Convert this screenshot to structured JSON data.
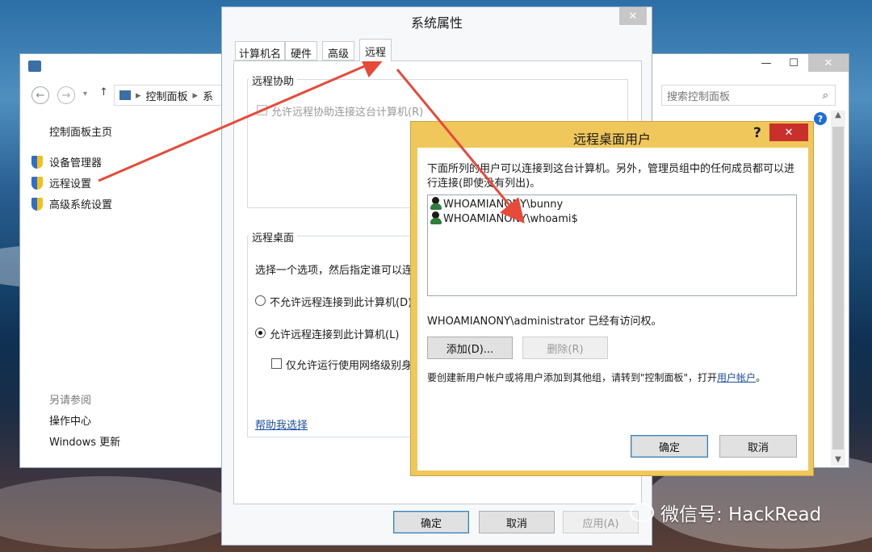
{
  "control_panel": {
    "breadcrumb_root": "控制面板",
    "breadcrumb_next": "系",
    "search_placeholder": "搜索控制面板",
    "home_link": "控制面板主页",
    "nav": [
      "设备管理器",
      "远程设置",
      "高级系统设置"
    ],
    "see_also_title": "另请参阅",
    "see_also": [
      "操作中心",
      "Windows 更新"
    ],
    "icons": [
      "back-icon",
      "forward-icon",
      "up-arrow-icon",
      "search-icon",
      "help-icon",
      "shield-icon"
    ]
  },
  "system_properties": {
    "title": "系统属性",
    "tabs": [
      "计算机名",
      "硬件",
      "高级",
      "远程"
    ],
    "active_tab": "远程",
    "remote_assistance": {
      "group_title": "远程协助",
      "checkbox_label": "允许远程协助连接这台计算机(R)"
    },
    "remote_desktop": {
      "group_title": "远程桌面",
      "intro": "选择一个选项，然后指定谁可以连",
      "option_deny": "不允许远程连接到此计算机(D)",
      "option_allow": "允许远程连接到此计算机(L)",
      "nla_label": "仅允许运行使用网络级别身",
      "help_link": "帮助我选择"
    },
    "buttons": {
      "ok": "确定",
      "cancel": "取消",
      "apply": "应用(A)"
    }
  },
  "rdu_dialog": {
    "title": "远程桌面用户",
    "help_glyph": "?",
    "description": "下面所列的用户可以连接到这台计算机。另外，管理员组中的任何成员都可以进行连接(即使没有列出)。",
    "users": [
      "WHOAMIANONY\\bunny",
      "WHOAMIANONY\\whoami$"
    ],
    "access_note": "WHOAMIANONY\\administrator 已经有访问权。",
    "add_button": "添加(D)...",
    "remove_button": "删除(R)",
    "footer_text": "要创建新用户帐户或将用户添加到其他组，请转到\"控制面板\"，打开",
    "footer_link": "用户帐户",
    "footer_end": "。",
    "ok_button": "确定",
    "cancel_button": "取消"
  },
  "watermark": "微信号: HackRead",
  "colors": {
    "dialog_border": "#f0c75b",
    "close_red": "#c9302c",
    "link": "#1c4fa8",
    "arrow": "#e84a3a"
  }
}
